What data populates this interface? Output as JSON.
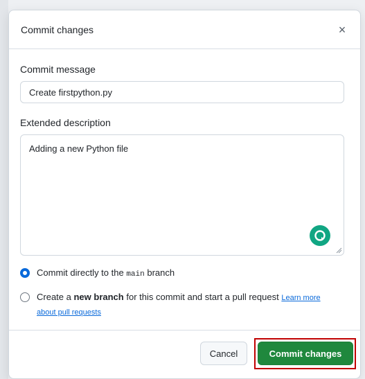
{
  "dialog": {
    "title": "Commit changes",
    "close_symbol": "×"
  },
  "commit_message": {
    "label": "Commit message",
    "value": "Create firstpython.py"
  },
  "extended_description": {
    "label": "Extended description",
    "value": "Adding a new Python file"
  },
  "options": {
    "direct": {
      "prefix": "Commit directly to the ",
      "branch": "main",
      "suffix": " branch",
      "checked": true
    },
    "new_branch": {
      "prefix": "Create a ",
      "bold": "new branch",
      "suffix": " for this commit and start a pull request ",
      "link_text": "Learn more about pull requests",
      "checked": false
    }
  },
  "footer": {
    "cancel_label": "Cancel",
    "commit_label": "Commit changes"
  },
  "colors": {
    "primary_button": "#1f883d",
    "highlight_border": "#c00000",
    "radio_accent": "#0969da"
  },
  "icons": {
    "close": "close-icon",
    "assistant": "grammarly-icon",
    "resize": "resize-handle-icon"
  }
}
